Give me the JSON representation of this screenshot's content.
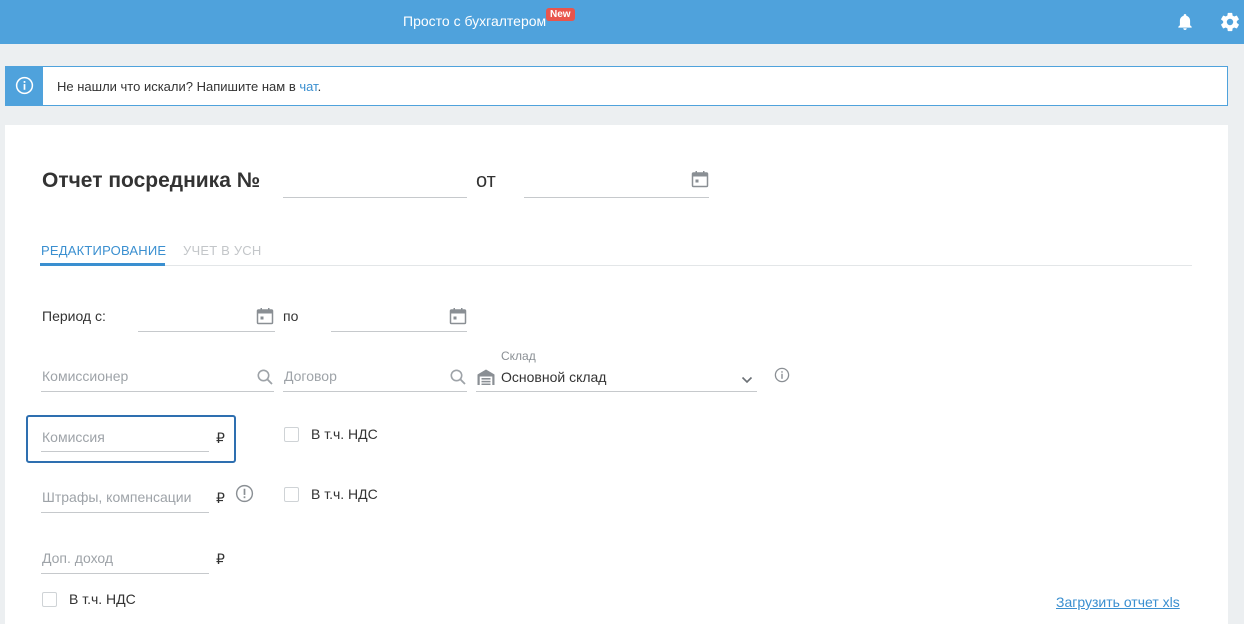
{
  "header": {
    "brand": "Просто с бухгалтером",
    "badge": "New",
    "icons": [
      "bell-icon",
      "gear-icon"
    ]
  },
  "notice": {
    "text": "Не нашли что искали? Напишите нам в ",
    "link": "чат",
    "after": ".",
    "icon": "info-icon"
  },
  "form": {
    "title": "Отчет посредника №",
    "number_value": "",
    "from_label": "от",
    "date_value": ""
  },
  "tabs": [
    {
      "label": "РЕДАКТИРОВАНИЕ",
      "active": true
    },
    {
      "label": "УЧЕТ В УСН",
      "active": false
    }
  ],
  "period": {
    "label": "Период с:",
    "to_label": "по"
  },
  "fields": {
    "commissioner_placeholder": "Комиссионер",
    "contract_placeholder": "Договор",
    "warehouse_label": "Склад",
    "warehouse_value": "Основной склад",
    "commission_placeholder": "Комиссия",
    "penalties_placeholder": "Штрафы, компенсации",
    "extra_income_placeholder": "Доп. доход",
    "currency": "₽",
    "vat_label": "В т.ч. НДС"
  },
  "actions": {
    "upload_link": "Загрузить отчет xls"
  },
  "colors": {
    "brand": "#4fa2dc",
    "accent": "#3a8fd0",
    "badge": "#e9554c",
    "focus": "#2e6fb0"
  }
}
